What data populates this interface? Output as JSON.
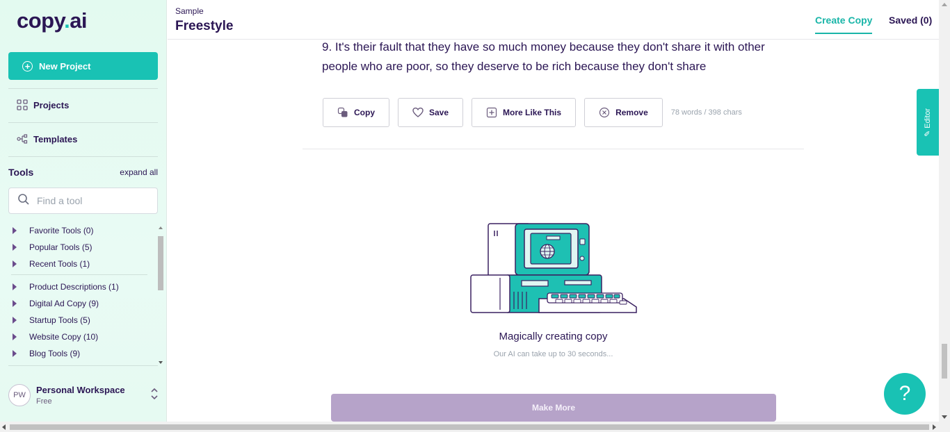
{
  "logo": {
    "prefix": "copy",
    "dot": ".",
    "suffix": "ai"
  },
  "sidebar": {
    "new_project_label": "New Project",
    "nav": [
      {
        "label": "Projects",
        "icon": "grid-icon"
      },
      {
        "label": "Templates",
        "icon": "share-nodes-icon"
      }
    ],
    "tools_title": "Tools",
    "expand_all": "expand all",
    "search_placeholder": "Find a tool",
    "tool_groups": [
      {
        "label": "Favorite Tools (0)"
      },
      {
        "label": "Popular Tools (5)"
      },
      {
        "label": "Recent Tools (1)"
      },
      {
        "label": "Product Descriptions (1)"
      },
      {
        "label": "Digital Ad Copy (9)"
      },
      {
        "label": "Startup Tools (5)"
      },
      {
        "label": "Website Copy (10)"
      },
      {
        "label": "Blog Tools (9)"
      }
    ],
    "workspace": {
      "initials": "PW",
      "name": "Personal Workspace",
      "plan": "Free"
    }
  },
  "header": {
    "subtitle": "Sample",
    "title": "Freestyle",
    "tabs": [
      {
        "label": "Create Copy",
        "active": true
      },
      {
        "label": "Saved (0)",
        "active": false
      }
    ]
  },
  "result": {
    "text": "9. It's their fault that they have so much money because they don't share it with other people who are poor, so they deserve to be rich because they don't share",
    "actions": [
      {
        "label": "Copy",
        "icon": "copy-icon"
      },
      {
        "label": "Save",
        "icon": "heart-icon"
      },
      {
        "label": "More Like This",
        "icon": "plus-square-icon"
      },
      {
        "label": "Remove",
        "icon": "x-circle-icon"
      }
    ],
    "meta": "78 words / 398 chars"
  },
  "loading": {
    "title": "Magically creating copy",
    "subtitle": "Our AI can take up to 30 seconds..."
  },
  "make_more_label": "Make More",
  "editor_tab_label": "Editor",
  "help_label": "?",
  "colors": {
    "accent": "#19c2b4",
    "brand_dark": "#2b1654",
    "make_more": "#b6a3c9"
  }
}
